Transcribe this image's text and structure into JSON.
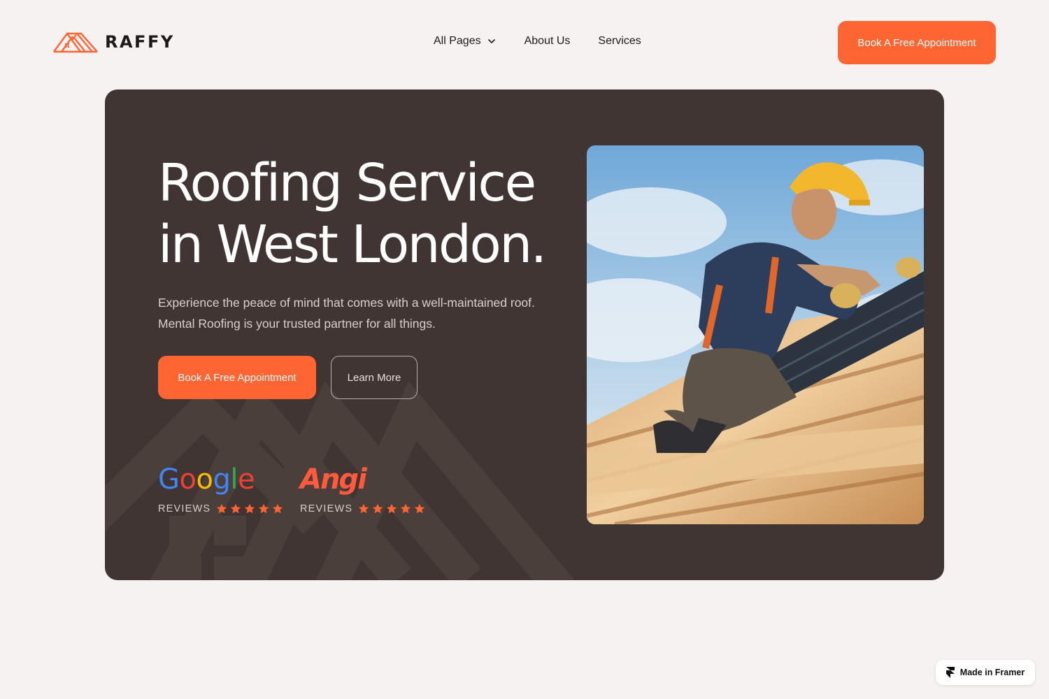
{
  "header": {
    "logo_text": "RAFFY",
    "logo_icon": "roof-house-icon",
    "nav": [
      {
        "label": "All Pages",
        "icon": "chevron-down-icon"
      },
      {
        "label": "About Us"
      },
      {
        "label": "Services"
      }
    ],
    "cta_label": "Book A Free Appointment"
  },
  "hero": {
    "title_line1": "Roofing Service",
    "title_line2": "in West London.",
    "description_line1": "Experience the peace of mind that comes with a well-maintained roof.",
    "description_line2": "Mental Roofing is your trusted partner for all things.",
    "primary_cta": "Book A Free Appointment",
    "secondary_cta": "Learn More",
    "photo": "roofer-working-on-roof-image",
    "reviews": [
      {
        "brand": "Google",
        "label": "REVIEWS",
        "stars": 5
      },
      {
        "brand": "Angi",
        "label": "REVIEWS",
        "stars": 5
      }
    ]
  },
  "badge": {
    "label": "Made in Framer",
    "icon": "framer-icon"
  },
  "colors": {
    "accent": "#ff6533",
    "hero_background": "#413533",
    "page_background": "#f6f2f1",
    "star": "#ff6533",
    "google_blue": "#4285f4",
    "google_red": "#ea4335",
    "google_yellow": "#fbbc05",
    "google_green": "#34a853",
    "angi_red": "#ff5a3c"
  }
}
